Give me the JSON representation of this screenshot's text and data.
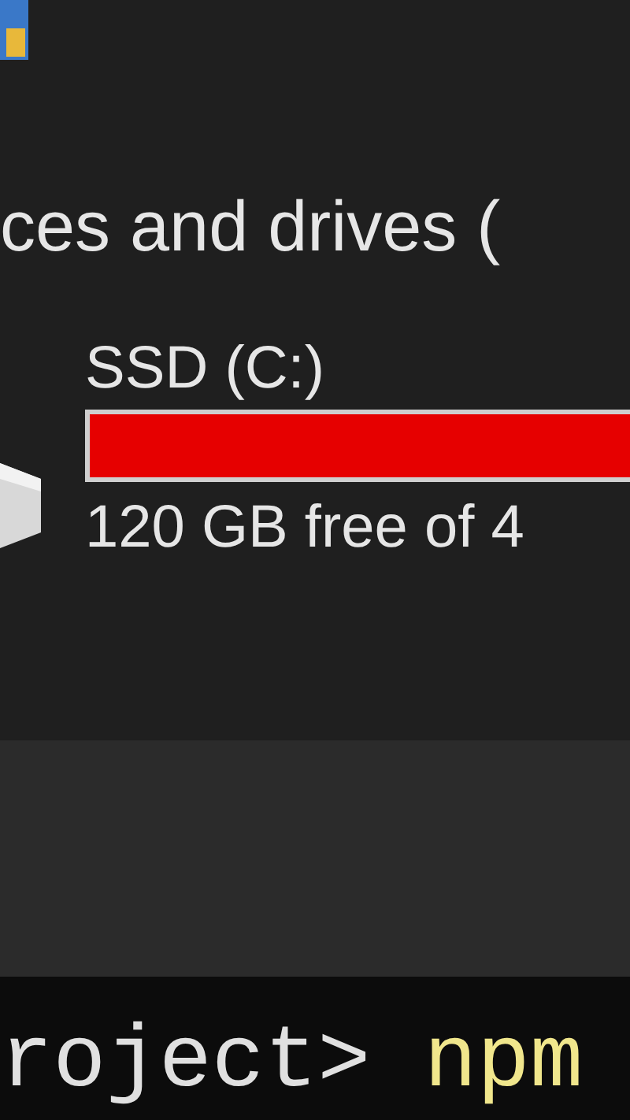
{
  "section": {
    "title": "ces and drives ("
  },
  "drive": {
    "name": "SSD (C:)",
    "level": 0.9,
    "space": "120 GB free of 4"
  },
  "terminal": {
    "path": "roject>",
    "command": "npm"
  }
}
